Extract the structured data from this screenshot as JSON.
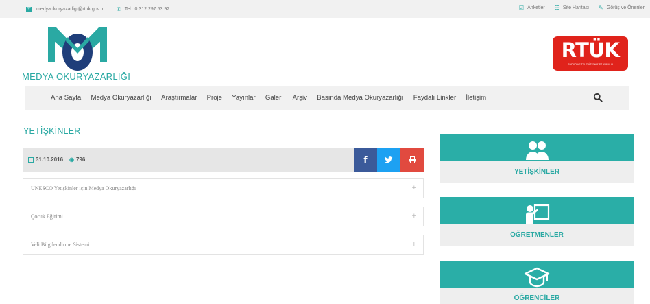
{
  "topbar": {
    "email": "medyaokuryazarligi@rtuk.gov.tr",
    "phone": "Tel : 0 312 297 53 92",
    "links": [
      "Anketler",
      "Site Haritası",
      "Görüş ve Öneriler"
    ]
  },
  "header": {
    "logo_text": "MEDYA OKURYAZARLIĞI",
    "rtuk_title": "RTÜK",
    "rtuk_subtitle": "RADYO VE TELEVİZYON ÜST KURULU"
  },
  "nav": {
    "items": [
      "Ana Sayfa",
      "Medya Okuryazarlığı",
      "Araştırmalar",
      "Proje",
      "Yayınlar",
      "Galeri",
      "Arşiv",
      "Basında Medya Okuryazarlığı",
      "Faydalı Linkler",
      "İletişim"
    ]
  },
  "content": {
    "title": "YETİŞKİNLER",
    "date": "31.10.2016",
    "views": "796",
    "accordion": [
      "UNESCO Yetişkinler için Medya Okuryazarlığı",
      "Çocuk Eğitimi",
      "Veli Bilgilendirme Sistemi"
    ]
  },
  "sidebar": {
    "cards": [
      "YETİŞKİNLER",
      "ÖĞRETMENLER",
      "ÖĞRENCİLER"
    ]
  },
  "colors": {
    "accent": "#2aa9a3",
    "rtuk_red": "#e0231b",
    "facebook": "#3b5a9a",
    "twitter": "#1da1f2",
    "print": "#e14a3f"
  }
}
